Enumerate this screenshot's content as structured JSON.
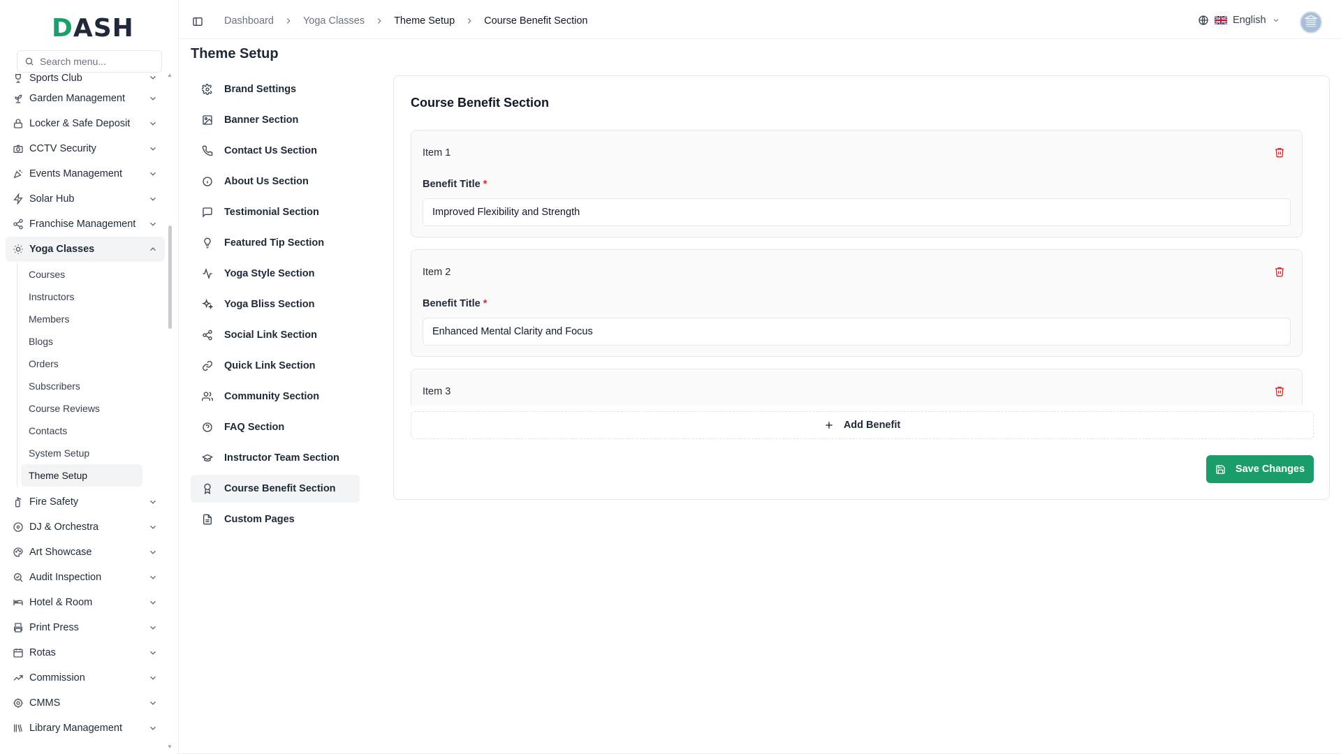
{
  "brand": {
    "logo_text": "DASH"
  },
  "search": {
    "placeholder": "Search menu..."
  },
  "sidebar": {
    "items": [
      {
        "label": "Sports Club",
        "icon": "trophy-icon"
      },
      {
        "label": "Garden Management",
        "icon": "plant-icon"
      },
      {
        "label": "Locker & Safe Deposit",
        "icon": "lock-icon"
      },
      {
        "label": "CCTV Security",
        "icon": "camera-icon"
      },
      {
        "label": "Events Management",
        "icon": "party-icon"
      },
      {
        "label": "Solar Hub",
        "icon": "bolt-icon"
      },
      {
        "label": "Franchise Management",
        "icon": "share-icon"
      },
      {
        "label": "Yoga Classes",
        "icon": "sun-icon"
      },
      {
        "label": "Fire Safety",
        "icon": "extinguisher-icon"
      },
      {
        "label": "DJ & Orchestra",
        "icon": "disc-icon"
      },
      {
        "label": "Art Showcase",
        "icon": "palette-icon"
      },
      {
        "label": "Audit Inspection",
        "icon": "search-check-icon"
      },
      {
        "label": "Hotel & Room",
        "icon": "bed-icon"
      },
      {
        "label": "Print Press",
        "icon": "printer-icon"
      },
      {
        "label": "Rotas",
        "icon": "calendar-icon"
      },
      {
        "label": "Commission",
        "icon": "trend-up-icon"
      },
      {
        "label": "CMMS",
        "icon": "cog-icon"
      },
      {
        "label": "Library Management",
        "icon": "books-icon"
      }
    ],
    "sub_items": [
      "Courses",
      "Instructors",
      "Members",
      "Blogs",
      "Orders",
      "Subscribers",
      "Course Reviews",
      "Contacts",
      "System Setup",
      "Theme Setup"
    ]
  },
  "topbar": {
    "breadcrumbs": [
      "Dashboard",
      "Yoga Classes",
      "Theme Setup",
      "Course Benefit Section"
    ],
    "language": "English"
  },
  "page": {
    "title": "Theme Setup"
  },
  "theme_menu": [
    {
      "label": "Brand Settings",
      "icon": "settings-icon"
    },
    {
      "label": "Banner Section",
      "icon": "image-icon"
    },
    {
      "label": "Contact Us Section",
      "icon": "phone-icon"
    },
    {
      "label": "About Us Section",
      "icon": "info-icon"
    },
    {
      "label": "Testimonial Section",
      "icon": "message-icon"
    },
    {
      "label": "Featured Tip Section",
      "icon": "lightbulb-icon"
    },
    {
      "label": "Yoga Style Section",
      "icon": "activity-icon"
    },
    {
      "label": "Yoga Bliss Section",
      "icon": "sparkles-icon"
    },
    {
      "label": "Social Link Section",
      "icon": "share-icon"
    },
    {
      "label": "Quick Link Section",
      "icon": "link-icon"
    },
    {
      "label": "Community Section",
      "icon": "users-icon"
    },
    {
      "label": "FAQ Section",
      "icon": "help-circle-icon"
    },
    {
      "label": "Instructor Team Section",
      "icon": "graduation-cap-icon"
    },
    {
      "label": "Course Benefit Section",
      "icon": "award-icon"
    },
    {
      "label": "Custom Pages",
      "icon": "file-text-icon"
    }
  ],
  "card": {
    "title": "Course Benefit Section",
    "field_label": "Benefit Title",
    "required_mark": "*",
    "items": [
      {
        "label": "Item 1",
        "value": "Improved Flexibility and Strength"
      },
      {
        "label": "Item 2",
        "value": "Enhanced Mental Clarity and Focus"
      },
      {
        "label": "Item 3",
        "value": ""
      }
    ],
    "add_label": "Add Benefit",
    "save_label": "Save Changes"
  },
  "colors": {
    "accent": "#1a9d6b",
    "danger": "#dc2626"
  }
}
